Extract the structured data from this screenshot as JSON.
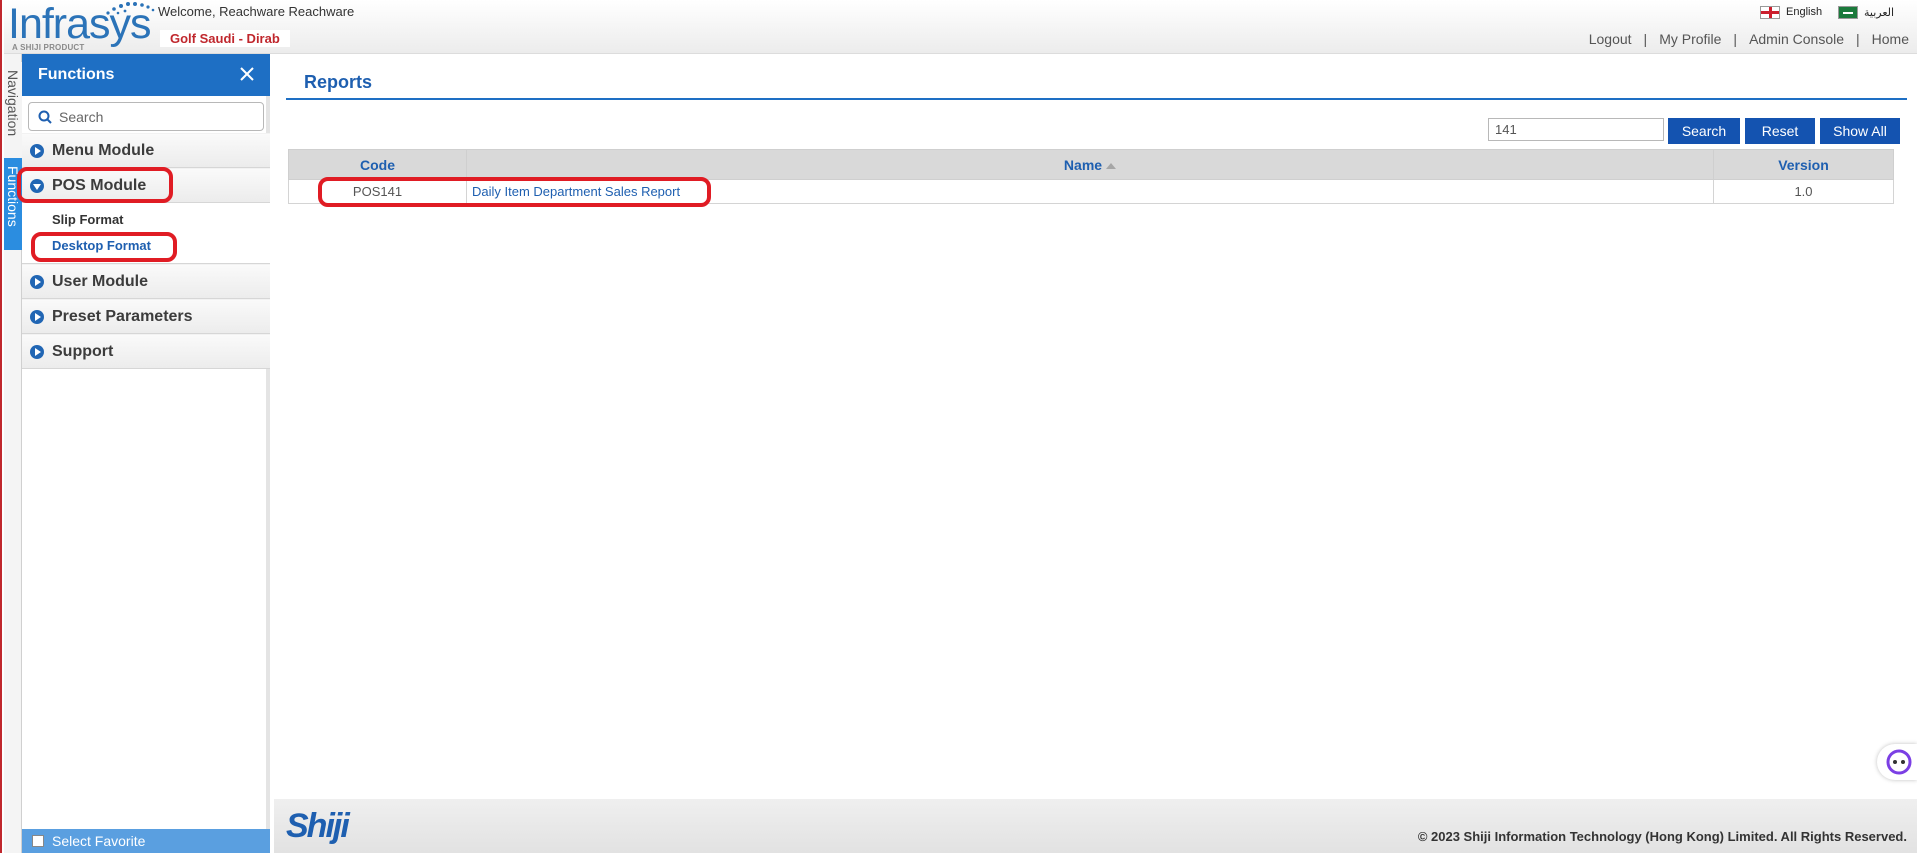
{
  "header": {
    "logo_text": "Infrasys",
    "logo_subtext": "A SHIJI PRODUCT",
    "welcome_text": "Welcome, Reachware Reachware",
    "property_name": "Golf Saudi - Dirab",
    "languages": [
      {
        "label": "English",
        "icon": "uk-flag-icon"
      },
      {
        "label": "العربية",
        "icon": "saudi-flag-icon"
      }
    ],
    "links": [
      "Logout",
      "My Profile",
      "Admin Console",
      "Home"
    ],
    "link_separator": "|"
  },
  "side_tabs": {
    "navigation": "Navigation",
    "functions": "Functions"
  },
  "functions_panel": {
    "title": "Functions",
    "search_placeholder": "Search",
    "modules": [
      {
        "label": "Menu Module",
        "expanded": false
      },
      {
        "label": "POS Module",
        "expanded": true,
        "items": [
          "Slip Format",
          "Desktop Format"
        ]
      },
      {
        "label": "User Module",
        "expanded": false
      },
      {
        "label": "Preset Parameters",
        "expanded": false
      },
      {
        "label": "Support",
        "expanded": false
      }
    ],
    "favorite_label": "Select Favorite"
  },
  "main": {
    "title": "Reports",
    "filter_value": "141",
    "buttons": {
      "search": "Search",
      "reset": "Reset",
      "show_all": "Show All"
    },
    "table": {
      "columns": [
        "Code",
        "Name",
        "Version"
      ],
      "sorted_column": "Name",
      "rows": [
        {
          "code": "POS141",
          "name": "Daily Item Department Sales Report",
          "version": "1.0"
        }
      ]
    }
  },
  "footer": {
    "logo_text": "Shiji",
    "copyright": "© 2023 Shiji Information Technology (Hong Kong) Limited. All Rights Reserved."
  },
  "colors": {
    "brand_blue": "#1e6fc4",
    "button_blue": "#1453b0",
    "annotation_red": "#e01c24",
    "property_red": "#c0272d"
  }
}
